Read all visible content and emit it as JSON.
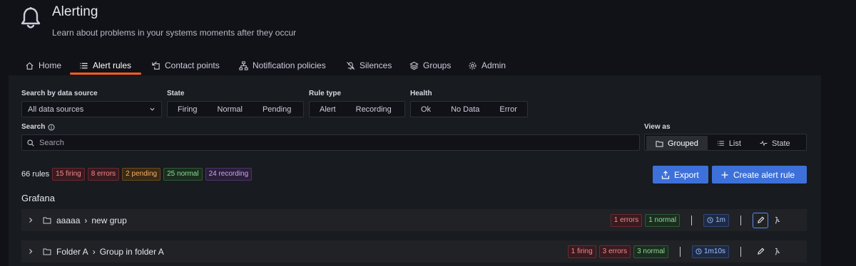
{
  "header": {
    "title": "Alerting",
    "subtitle": "Learn about problems in your systems moments after they occur",
    "icon": "bell-icon"
  },
  "tabs": [
    {
      "label": "Home",
      "icon": "home-icon"
    },
    {
      "label": "Alert rules",
      "icon": "list-icon",
      "active": true
    },
    {
      "label": "Contact points",
      "icon": "contact-icon"
    },
    {
      "label": "Notification policies",
      "icon": "sitemap-icon"
    },
    {
      "label": "Silences",
      "icon": "bell-slash-icon"
    },
    {
      "label": "Groups",
      "icon": "layers-icon"
    },
    {
      "label": "Admin",
      "icon": "cog-icon"
    }
  ],
  "filters": {
    "datasource_label": "Search by data source",
    "datasource_value": "All data sources",
    "state_label": "State",
    "state_options": [
      "Firing",
      "Normal",
      "Pending"
    ],
    "ruletype_label": "Rule type",
    "ruletype_options": [
      "Alert",
      "Recording"
    ],
    "health_label": "Health",
    "health_options": [
      "Ok",
      "No Data",
      "Error"
    ],
    "search_label": "Search",
    "search_placeholder": "Search",
    "viewas_label": "View as",
    "viewas_options": [
      "Grouped",
      "List",
      "State"
    ],
    "viewas_selected": "Grouped"
  },
  "summary": {
    "count": "66 rules",
    "firing": "15 firing",
    "errors": "8 errors",
    "pending": "2 pending",
    "normal": "25 normal",
    "recording": "24 recording"
  },
  "actions": {
    "export": "Export",
    "create": "Create alert rule"
  },
  "section": "Grafana",
  "groups": [
    {
      "folder": "aaaaa",
      "separator": "›",
      "group": "new grup",
      "errors": "1 errors",
      "normal": "1 normal",
      "interval": "1m"
    },
    {
      "folder": "Folder A",
      "separator": "›",
      "group": "Group in folder A",
      "firing": "1 firing",
      "errors": "3 errors",
      "normal": "3 normal",
      "interval": "1m10s"
    }
  ],
  "colors": {
    "accent": "#ff5e1f",
    "primary_button": "#3d71d9",
    "background": "#111217",
    "panel": "#181b1f"
  }
}
